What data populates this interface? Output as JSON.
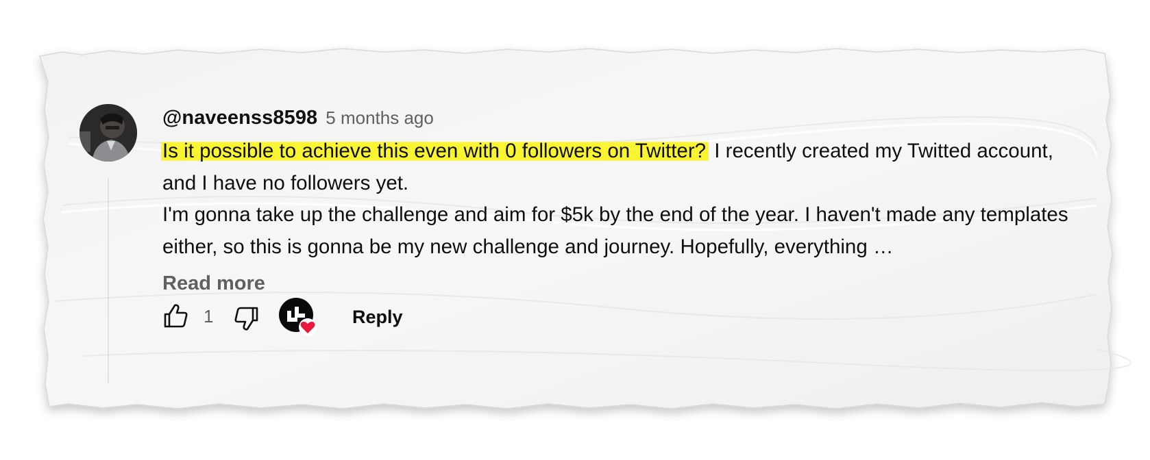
{
  "comment": {
    "author": "@naveenss8598",
    "timestamp": "5 months ago",
    "highlighted_text": "Is it possible to achieve this even with 0 followers on Twitter?",
    "line1_rest": " I recently created my Twitted account, and I have no followers yet.",
    "line2": "I'm gonna take up the challenge and aim for $5k by the end of the year. I haven't made any templates either, so this is gonna be my new challenge and journey. Hopefully, everything",
    "ellipsis": " …",
    "read_more_label": "Read more",
    "like_count": "1",
    "reply_label": "Reply"
  },
  "icons": {
    "like": "thumbs-up-icon",
    "dislike": "thumbs-down-icon",
    "creator_heart": "creator-heart-icon"
  },
  "colors": {
    "highlight": "#f8f430",
    "heart": "#e8193c",
    "secondary_text": "#606060"
  }
}
